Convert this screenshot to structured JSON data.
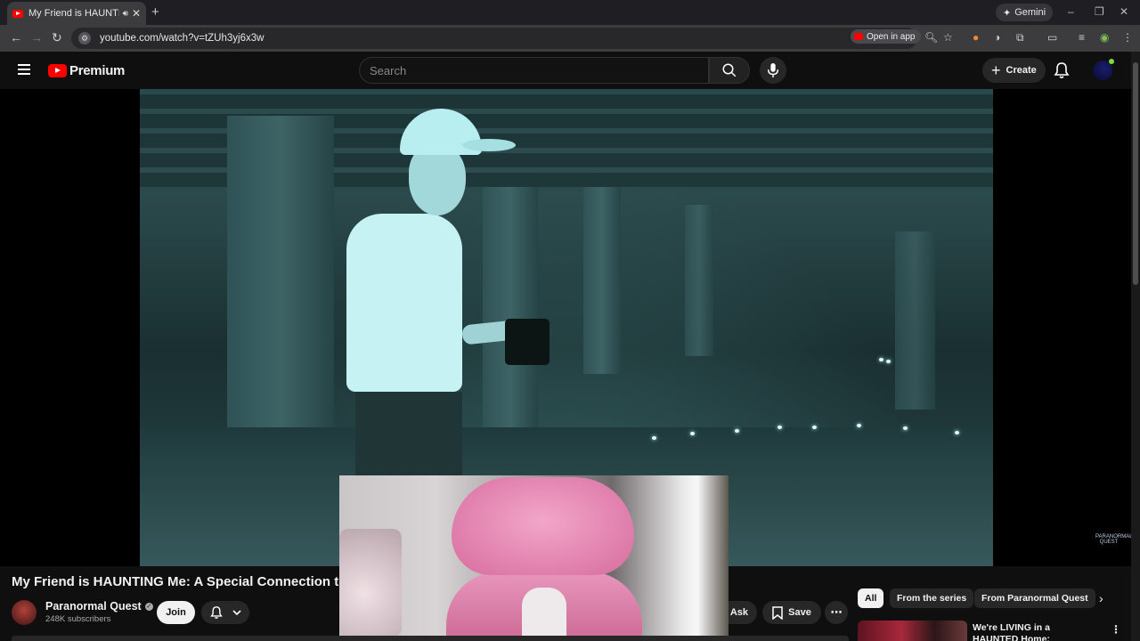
{
  "browser": {
    "tab_title": "My Friend is HAUNTING Me",
    "url": "youtube.com/watch?v=tZUh3yj6x3w",
    "open_in_app": "Open in app",
    "gemini_label": "Gemini"
  },
  "header": {
    "logo_text": "Premium",
    "search_placeholder": "Search",
    "create_label": "Create"
  },
  "video": {
    "title": "My Friend is HAUNTING Me: A Special Connection to a G",
    "watermark": "PARANORMAL QUEST"
  },
  "channel": {
    "name": "Paranormal Quest",
    "subscribers": "248K subscribers",
    "join_label": "Join"
  },
  "actions": {
    "ask_label": "Ask",
    "save_label": "Save",
    "more_label": "⋯"
  },
  "chips": [
    {
      "label": "All",
      "active": true
    },
    {
      "label": "From the series",
      "active": false
    },
    {
      "label": "From Paranormal Quest",
      "active": false
    }
  ],
  "recommendation": {
    "title": "We're LIVING in a HAUNTED Home: Paranormal Activity"
  },
  "colors": {
    "brand": "#ff0000",
    "background": "#0f0f0f",
    "chip_bg": "#272727",
    "webcam_chair": "#e896bd"
  }
}
